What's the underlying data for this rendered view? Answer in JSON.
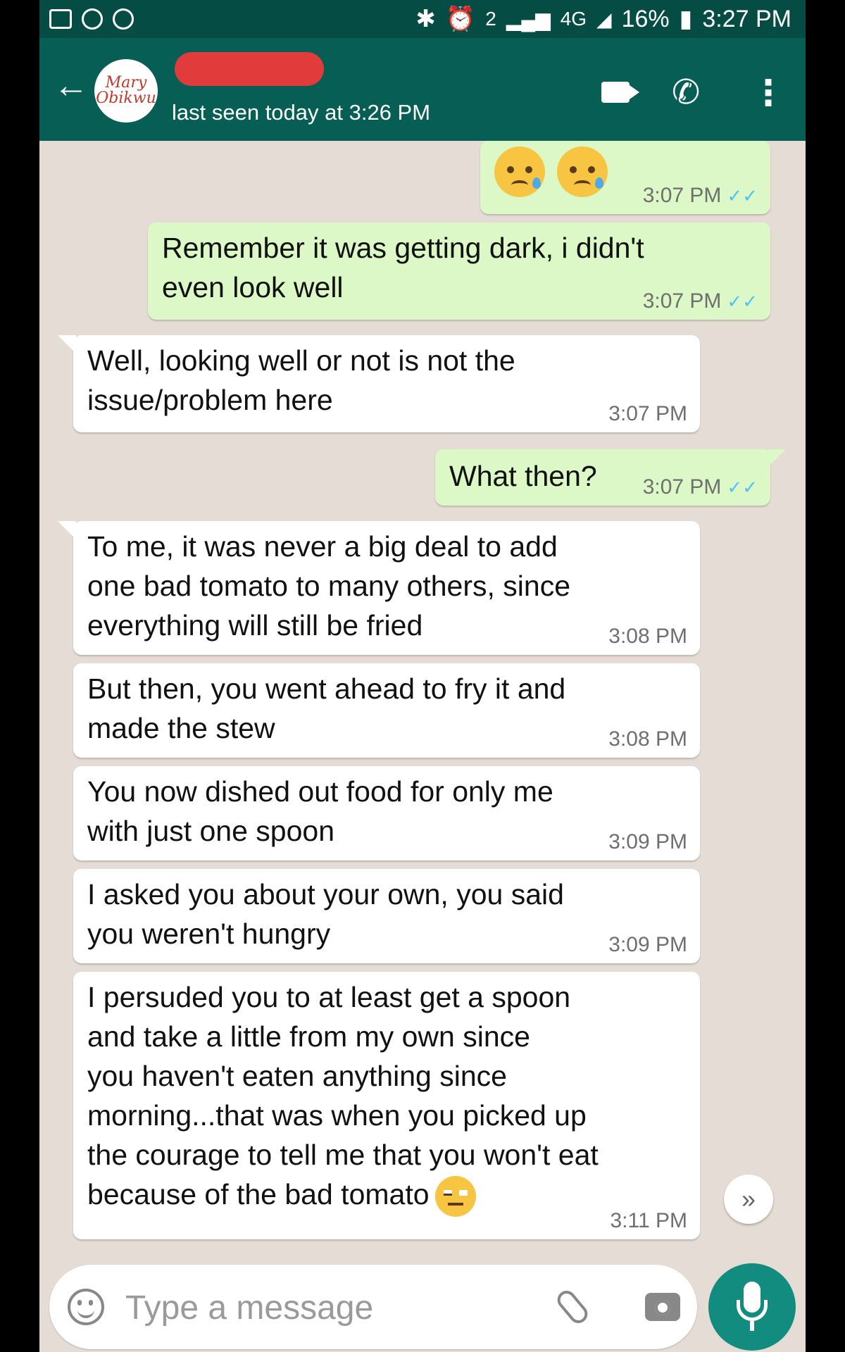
{
  "status_bar": {
    "network": "4G",
    "sim": "2",
    "battery": "16%",
    "time": "3:27 PM"
  },
  "header": {
    "avatar_text": "Mary Obikwu",
    "last_seen": "last seen today at 3:26 PM"
  },
  "messages": [
    {
      "direction": "sent",
      "text": "",
      "time": "3:07 PM",
      "emojis": [
        "sad-tear",
        "sad-tear"
      ]
    },
    {
      "direction": "sent",
      "lines": [
        "Remember it was getting dark, i didn't",
        "even look well"
      ],
      "time": "3:07 PM"
    },
    {
      "direction": "received",
      "lines": [
        "Well, looking well or not is not the",
        "issue/problem here"
      ],
      "time": "3:07 PM"
    },
    {
      "direction": "sent",
      "lines": [
        "What then?"
      ],
      "time": "3:07 PM"
    },
    {
      "direction": "received",
      "lines": [
        "To me, it was never a big deal to add",
        "one bad tomato to many others, since",
        "everything will still be fried"
      ],
      "time": "3:08 PM"
    },
    {
      "direction": "received",
      "lines": [
        "But then, you went ahead to fry it and",
        "made the stew"
      ],
      "time": "3:08 PM"
    },
    {
      "direction": "received",
      "lines": [
        "You now dished out food for only me",
        "with just one spoon"
      ],
      "time": "3:09 PM"
    },
    {
      "direction": "received",
      "lines": [
        "I asked you about your own, you said",
        "you weren't hungry"
      ],
      "time": "3:09 PM"
    },
    {
      "direction": "received",
      "lines": [
        "I persuded you to at least get a spoon",
        "and take a little from my own since",
        "you haven't eaten anything since",
        "morning...that was when you picked up",
        "the courage to tell me that you won't eat",
        "because of the bad tomato"
      ],
      "time": "3:11 PM",
      "trailing_emoji": "unamused"
    }
  ],
  "composer": {
    "placeholder": "Type a message"
  },
  "colors": {
    "header": "#075e54",
    "status_bar": "#054d44",
    "chat_bg": "#e5ddd5",
    "sent_bubble": "#dcf8c6",
    "received_bubble": "#ffffff",
    "read_ticks": "#4fc3f7",
    "mic_button": "#128c7e"
  }
}
